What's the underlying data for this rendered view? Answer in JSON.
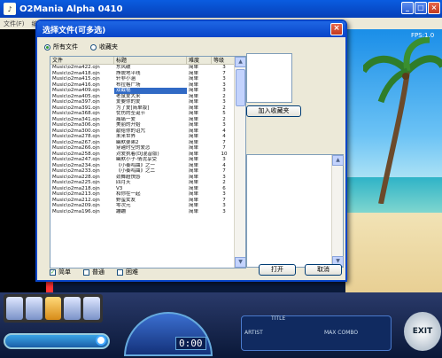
{
  "app": {
    "title": "O2Mania Alpha 0410",
    "icon_text": "♪",
    "menu": [
      "文件(F)",
      "编辑(E)"
    ],
    "fps": "FPS:1.0",
    "controls": {
      "minimize": "_",
      "maximize": "□",
      "close": "×"
    }
  },
  "dialog": {
    "title": "选择文件(可多选)",
    "close_label": "×",
    "radios": [
      {
        "label": "所有文件",
        "checked": true
      },
      {
        "label": "收藏夹",
        "checked": false
      }
    ],
    "columns": [
      "文件",
      "标题",
      "难度",
      "等级"
    ],
    "rows": [
      [
        "Music\\o2ma422.ojn",
        "东风破",
        "简单",
        "3"
      ],
      [
        "Music\\o2ma418.ojn",
        "挣脱地平线",
        "简单",
        "7"
      ],
      [
        "Music\\o2ma415.ojn",
        "轩非小涵",
        "简单",
        "3"
      ],
      [
        "Music\\o2ma416.ojn",
        "布拉格广场",
        "简单",
        "3"
      ],
      [
        "Music\\o2ma409.ojn",
        "双截棍",
        "简单",
        "3"
      ],
      [
        "Music\\o2ma405.ojn",
        "老鼠爱大米",
        "简单",
        "2"
      ],
      [
        "Music\\o2ma397.ojn",
        "爱要你的爱",
        "简单",
        "3"
      ],
      [
        "Music\\o2ma391.ojn",
        "为了爱[简单版]",
        "简单",
        "2"
      ],
      [
        "Music\\o2ma368.ojn",
        "忧伤的圣诞节",
        "简单",
        "5"
      ],
      [
        "Music\\o2ma341.ojn",
        "痛痛一爱",
        "简单",
        "2"
      ],
      [
        "Music\\o2ma306.ojn",
        "美丽的开始",
        "简单",
        "3"
      ],
      [
        "Music\\o2ma300.ojn",
        "献给你的诅咒",
        "简单",
        "4"
      ],
      [
        "Music\\o2ma278.ojn",
        "未来世界",
        "简单",
        "4"
      ],
      [
        "Music\\o2ma267.ojn",
        "幽默婆弟2",
        "简单",
        "7"
      ],
      [
        "Music\\o2ma266.ojn",
        "穿越时空的爱恋",
        "简单",
        "7"
      ],
      [
        "Music\\o2ma258.ojn",
        "对爱执着(DJ混音版)",
        "简单",
        "10"
      ],
      [
        "Music\\o2ma247.ojn",
        "幽默小子-倩沈享受",
        "简单",
        "3"
      ],
      [
        "Music\\o2ma234.ojn",
        "《小奏鸣曲》之一",
        "简单",
        "4"
      ],
      [
        "Music\\o2ma233.ojn",
        "《小奏鸣曲》之二",
        "简单",
        "7"
      ],
      [
        "Music\\o2ma228.ojn",
        "劲舞超快感",
        "简单",
        "3"
      ],
      [
        "Music\\o2ma225.ojn",
        "四月天",
        "简单",
        "2"
      ],
      [
        "Music\\o2ma218.ojn",
        "V3",
        "简单",
        "6"
      ],
      [
        "Music\\o2ma213.ojn",
        "和你在一起",
        "简单",
        "3"
      ],
      [
        "Music\\o2ma212.ojn",
        "野蛮女友",
        "简单",
        "7"
      ],
      [
        "Music\\o2ma209.ojn",
        "零次元",
        "简单",
        "3"
      ],
      [
        "Music\\o2ma196.ojn",
        "蹦蹦",
        "简单",
        "3"
      ]
    ],
    "add_favorite_label": "加入收藏夹",
    "checkboxes": [
      {
        "label": "简单",
        "checked": true
      },
      {
        "label": "普通",
        "checked": false
      },
      {
        "label": "困难",
        "checked": false
      }
    ],
    "open_label": "打开",
    "cancel_label": "取消"
  },
  "hud": {
    "time": "0:00",
    "title_label": "TITLE",
    "artist_label": "ARTIST",
    "max_combo_label": "MAX COMBO",
    "exit_label": "EXIT"
  }
}
